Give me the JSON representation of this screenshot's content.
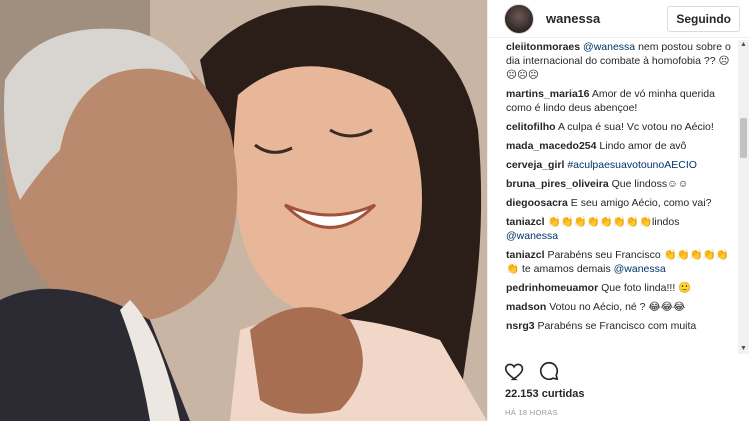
{
  "header": {
    "username": "wanessa",
    "follow_label": "Seguindo"
  },
  "comments": [
    {
      "user": "cleiitonmoraes",
      "mention": "@wanessa",
      "text": " nem postou sobre o dia internacional do combate à homofobia ?? ☹☹☹☹"
    },
    {
      "user": "martins_maria16",
      "mention": "",
      "text": "Amor de vó minha querida como é lindo deus abençoe!"
    },
    {
      "user": "celitofilho",
      "mention": "",
      "text": "A culpa é sua! Vc votou no Aécio!"
    },
    {
      "user": "mada_macedo254",
      "mention": "",
      "text": "Lindo amor de avô"
    },
    {
      "user": "cerveja_girl",
      "mention": "#aculpaesuavotounoAECIO",
      "text": ""
    },
    {
      "user": "bruna_pires_oliveira",
      "mention": "",
      "text": "Que lindoss☺☺"
    },
    {
      "user": "diegoosacra",
      "mention": "",
      "text": "E seu amigo Aécio, como vai?"
    },
    {
      "user": "taniazcl",
      "mention": "",
      "text": "👏👏👏👏👏👏👏👏lindos",
      "tail": "@wanessa"
    },
    {
      "user": "taniazcl",
      "mention": "",
      "text": "Parabéns seu Francisco 👏👏👏👏👏👏 te amamos demais",
      "tail": "@wanessa"
    },
    {
      "user": "pedrinhomeuamor",
      "mention": "",
      "text": "Que foto linda!!! 🙂"
    },
    {
      "user": "madson",
      "mention": "",
      "text": "Votou no Aécio, né ? 😂😂😂"
    },
    {
      "user": "nsrg3",
      "mention": "",
      "text": "Parabéns se Francisco com muita"
    }
  ],
  "footer": {
    "likes": "22.153 curtidas",
    "time": "HÁ 18 HORAS"
  },
  "icons": {
    "like": "heart-icon",
    "comment": "comment-icon"
  },
  "colors": {
    "mention": "#003569",
    "text": "#262626",
    "muted": "#999999"
  }
}
